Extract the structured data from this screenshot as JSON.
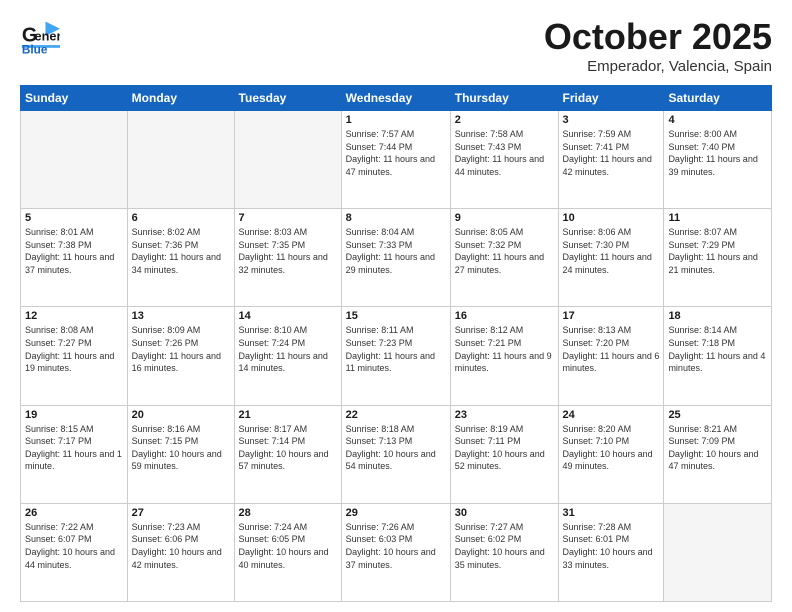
{
  "header": {
    "logo_line1": "General",
    "logo_line2": "Blue",
    "month": "October 2025",
    "location": "Emperador, Valencia, Spain"
  },
  "days_of_week": [
    "Sunday",
    "Monday",
    "Tuesday",
    "Wednesday",
    "Thursday",
    "Friday",
    "Saturday"
  ],
  "weeks": [
    [
      {
        "day": "",
        "sunrise": "",
        "sunset": "",
        "daylight": ""
      },
      {
        "day": "",
        "sunrise": "",
        "sunset": "",
        "daylight": ""
      },
      {
        "day": "",
        "sunrise": "",
        "sunset": "",
        "daylight": ""
      },
      {
        "day": "1",
        "sunrise": "Sunrise: 7:57 AM",
        "sunset": "Sunset: 7:44 PM",
        "daylight": "Daylight: 11 hours and 47 minutes."
      },
      {
        "day": "2",
        "sunrise": "Sunrise: 7:58 AM",
        "sunset": "Sunset: 7:43 PM",
        "daylight": "Daylight: 11 hours and 44 minutes."
      },
      {
        "day": "3",
        "sunrise": "Sunrise: 7:59 AM",
        "sunset": "Sunset: 7:41 PM",
        "daylight": "Daylight: 11 hours and 42 minutes."
      },
      {
        "day": "4",
        "sunrise": "Sunrise: 8:00 AM",
        "sunset": "Sunset: 7:40 PM",
        "daylight": "Daylight: 11 hours and 39 minutes."
      }
    ],
    [
      {
        "day": "5",
        "sunrise": "Sunrise: 8:01 AM",
        "sunset": "Sunset: 7:38 PM",
        "daylight": "Daylight: 11 hours and 37 minutes."
      },
      {
        "day": "6",
        "sunrise": "Sunrise: 8:02 AM",
        "sunset": "Sunset: 7:36 PM",
        "daylight": "Daylight: 11 hours and 34 minutes."
      },
      {
        "day": "7",
        "sunrise": "Sunrise: 8:03 AM",
        "sunset": "Sunset: 7:35 PM",
        "daylight": "Daylight: 11 hours and 32 minutes."
      },
      {
        "day": "8",
        "sunrise": "Sunrise: 8:04 AM",
        "sunset": "Sunset: 7:33 PM",
        "daylight": "Daylight: 11 hours and 29 minutes."
      },
      {
        "day": "9",
        "sunrise": "Sunrise: 8:05 AM",
        "sunset": "Sunset: 7:32 PM",
        "daylight": "Daylight: 11 hours and 27 minutes."
      },
      {
        "day": "10",
        "sunrise": "Sunrise: 8:06 AM",
        "sunset": "Sunset: 7:30 PM",
        "daylight": "Daylight: 11 hours and 24 minutes."
      },
      {
        "day": "11",
        "sunrise": "Sunrise: 8:07 AM",
        "sunset": "Sunset: 7:29 PM",
        "daylight": "Daylight: 11 hours and 21 minutes."
      }
    ],
    [
      {
        "day": "12",
        "sunrise": "Sunrise: 8:08 AM",
        "sunset": "Sunset: 7:27 PM",
        "daylight": "Daylight: 11 hours and 19 minutes."
      },
      {
        "day": "13",
        "sunrise": "Sunrise: 8:09 AM",
        "sunset": "Sunset: 7:26 PM",
        "daylight": "Daylight: 11 hours and 16 minutes."
      },
      {
        "day": "14",
        "sunrise": "Sunrise: 8:10 AM",
        "sunset": "Sunset: 7:24 PM",
        "daylight": "Daylight: 11 hours and 14 minutes."
      },
      {
        "day": "15",
        "sunrise": "Sunrise: 8:11 AM",
        "sunset": "Sunset: 7:23 PM",
        "daylight": "Daylight: 11 hours and 11 minutes."
      },
      {
        "day": "16",
        "sunrise": "Sunrise: 8:12 AM",
        "sunset": "Sunset: 7:21 PM",
        "daylight": "Daylight: 11 hours and 9 minutes."
      },
      {
        "day": "17",
        "sunrise": "Sunrise: 8:13 AM",
        "sunset": "Sunset: 7:20 PM",
        "daylight": "Daylight: 11 hours and 6 minutes."
      },
      {
        "day": "18",
        "sunrise": "Sunrise: 8:14 AM",
        "sunset": "Sunset: 7:18 PM",
        "daylight": "Daylight: 11 hours and 4 minutes."
      }
    ],
    [
      {
        "day": "19",
        "sunrise": "Sunrise: 8:15 AM",
        "sunset": "Sunset: 7:17 PM",
        "daylight": "Daylight: 11 hours and 1 minute."
      },
      {
        "day": "20",
        "sunrise": "Sunrise: 8:16 AM",
        "sunset": "Sunset: 7:15 PM",
        "daylight": "Daylight: 10 hours and 59 minutes."
      },
      {
        "day": "21",
        "sunrise": "Sunrise: 8:17 AM",
        "sunset": "Sunset: 7:14 PM",
        "daylight": "Daylight: 10 hours and 57 minutes."
      },
      {
        "day": "22",
        "sunrise": "Sunrise: 8:18 AM",
        "sunset": "Sunset: 7:13 PM",
        "daylight": "Daylight: 10 hours and 54 minutes."
      },
      {
        "day": "23",
        "sunrise": "Sunrise: 8:19 AM",
        "sunset": "Sunset: 7:11 PM",
        "daylight": "Daylight: 10 hours and 52 minutes."
      },
      {
        "day": "24",
        "sunrise": "Sunrise: 8:20 AM",
        "sunset": "Sunset: 7:10 PM",
        "daylight": "Daylight: 10 hours and 49 minutes."
      },
      {
        "day": "25",
        "sunrise": "Sunrise: 8:21 AM",
        "sunset": "Sunset: 7:09 PM",
        "daylight": "Daylight: 10 hours and 47 minutes."
      }
    ],
    [
      {
        "day": "26",
        "sunrise": "Sunrise: 7:22 AM",
        "sunset": "Sunset: 6:07 PM",
        "daylight": "Daylight: 10 hours and 44 minutes."
      },
      {
        "day": "27",
        "sunrise": "Sunrise: 7:23 AM",
        "sunset": "Sunset: 6:06 PM",
        "daylight": "Daylight: 10 hours and 42 minutes."
      },
      {
        "day": "28",
        "sunrise": "Sunrise: 7:24 AM",
        "sunset": "Sunset: 6:05 PM",
        "daylight": "Daylight: 10 hours and 40 minutes."
      },
      {
        "day": "29",
        "sunrise": "Sunrise: 7:26 AM",
        "sunset": "Sunset: 6:03 PM",
        "daylight": "Daylight: 10 hours and 37 minutes."
      },
      {
        "day": "30",
        "sunrise": "Sunrise: 7:27 AM",
        "sunset": "Sunset: 6:02 PM",
        "daylight": "Daylight: 10 hours and 35 minutes."
      },
      {
        "day": "31",
        "sunrise": "Sunrise: 7:28 AM",
        "sunset": "Sunset: 6:01 PM",
        "daylight": "Daylight: 10 hours and 33 minutes."
      },
      {
        "day": "",
        "sunrise": "",
        "sunset": "",
        "daylight": ""
      }
    ]
  ]
}
